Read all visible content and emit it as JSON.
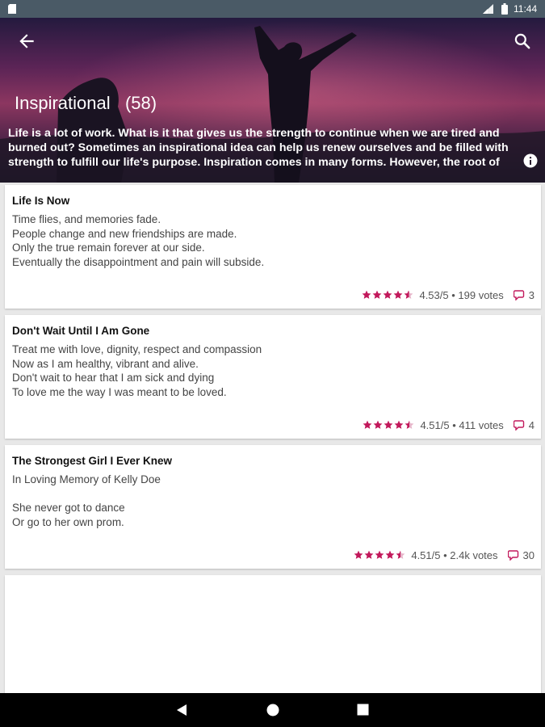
{
  "status_bar": {
    "time": "11:44"
  },
  "header": {
    "title": "Inspirational",
    "count": "(58)",
    "description": "Life is a lot of work. What is it that gives us the strength to continue when we are tired and burned out? Sometimes an inspirational idea can help us renew ourselves and be filled with strength to fulfill our life's purpose. Inspiration comes in many forms. However, the root of"
  },
  "icons": {
    "back": "arrow-back-icon",
    "search": "search-icon",
    "info": "info-icon",
    "star": "star-icon",
    "comment": "comment-icon"
  },
  "colors": {
    "star": "#c2185b",
    "comment_icon": "#c2185b",
    "status_bar": "#4a5a66"
  },
  "poems": [
    {
      "title": "Life Is Now",
      "lines": [
        "Time flies, and memories fade.",
        "People change and new friendships are made.",
        "Only the true remain forever at our side.",
        "Eventually the disappointment and pain will subside."
      ],
      "rating": 4.53,
      "rating_text": "4.53/5 • 199 votes",
      "comments": "3"
    },
    {
      "title": "Don't Wait Until I Am Gone",
      "lines": [
        "Treat me with love, dignity, respect and compassion",
        "Now as I am healthy, vibrant and alive.",
        "Don't wait to hear that I am sick and dying",
        "To love me the way I was meant to be loved."
      ],
      "rating": 4.51,
      "rating_text": "4.51/5 • 411 votes",
      "comments": "4"
    },
    {
      "title": "The Strongest Girl I Ever Knew",
      "lines": [
        "In Loving Memory of Kelly Doe",
        "",
        "She never got to dance",
        "Or go to her own prom."
      ],
      "rating": 4.51,
      "rating_text": "4.51/5 • 2.4k votes",
      "comments": "30"
    }
  ]
}
